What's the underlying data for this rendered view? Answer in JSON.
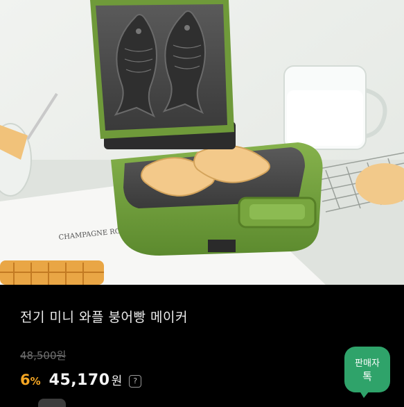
{
  "product": {
    "title": "전기 미니 와플 붕어빵 메이커",
    "original_price": "48,500원",
    "discount": "6",
    "discount_unit": "%",
    "price": "45,170",
    "price_unit": "원",
    "help_icon": "?"
  },
  "photo": {
    "magazine_text": "CHAMPAGNE ROSES"
  },
  "seller_chat": {
    "line1": "판매자",
    "line2": "톡"
  },
  "colors": {
    "background": "#000000",
    "discount": "#f5a623",
    "chat_button": "#2fa36a",
    "maker_green": "#6f9a3a"
  }
}
